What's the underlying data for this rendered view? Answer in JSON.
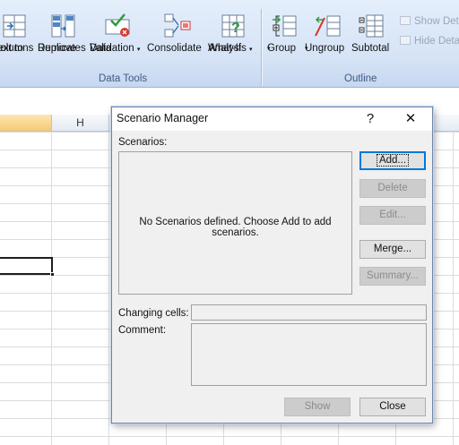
{
  "ribbon": {
    "data_tools": {
      "group_label": "Data Tools",
      "text_to_columns": {
        "line1": "Text to",
        "line2": "Columns"
      },
      "remove_duplicates": {
        "line1": "Remove",
        "line2": "Duplicates"
      },
      "data_validation": {
        "line1": "Data",
        "line2": "Validation"
      },
      "consolidate": {
        "line1": "Consolidate"
      },
      "what_if": {
        "line1": "What-If",
        "line2": "Analysis"
      }
    },
    "outline": {
      "group_label": "Outline",
      "group": "Group",
      "ungroup": "Ungroup",
      "subtotal": "Subtotal",
      "show_detail": "Show Deta",
      "hide_detail": "Hide Deta"
    },
    "dropdown_glyph": "▾"
  },
  "sheet": {
    "visible_column": "H"
  },
  "dialog": {
    "title": "Scenario Manager",
    "help_glyph": "?",
    "close_glyph": "✕",
    "scenarios_label": "Scenarios:",
    "empty_message": "No Scenarios defined. Choose Add to add scenarios.",
    "changing_cells_label": "Changing cells:",
    "comment_label": "Comment:",
    "buttons": {
      "add": "Add...",
      "delete": "Delete",
      "edit": "Edit...",
      "merge": "Merge...",
      "summary": "Summary...",
      "show": "Show",
      "close": "Close"
    }
  },
  "colors": {
    "ribbon_bg": "#d5e3f6",
    "dialog_bg": "#f0f0f0",
    "accent": "#0078d7"
  }
}
